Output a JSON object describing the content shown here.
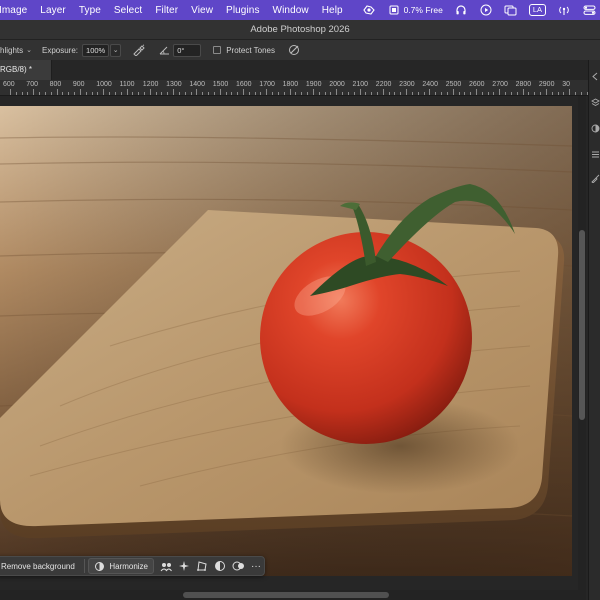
{
  "menubar": {
    "items": [
      "Image",
      "Layer",
      "Type",
      "Select",
      "Filter",
      "View",
      "Plugins",
      "Window",
      "Help"
    ],
    "status": {
      "cpu_text": "0.7% Free",
      "input_source": "LA"
    },
    "icons": [
      "menubar-app-icon",
      "cpu-monitor-icon",
      "headphones-icon",
      "play-icon",
      "window-icon",
      "input-source-icon",
      "antenna-icon",
      "control-center-icon"
    ]
  },
  "window": {
    "title": "Adobe Photoshop 2026"
  },
  "options_bar": {
    "range_value": "hlights",
    "exposure_label": "Exposure:",
    "exposure_value": "100%",
    "angle_value": "0°",
    "protect_tones_label": "Protect Tones",
    "protect_tones_checked": false
  },
  "document_tab": {
    "label": "RGB/8) *"
  },
  "ruler": {
    "labels": [
      "600",
      "700",
      "800",
      "900",
      "1000",
      "1100",
      "1200",
      "1300",
      "1400",
      "1500",
      "1600",
      "1700",
      "1800",
      "1900",
      "2000",
      "2100",
      "2200",
      "2300",
      "2400",
      "2500",
      "2600",
      "2700",
      "2800",
      "2900",
      "30"
    ]
  },
  "contextual_taskbar": {
    "remove_background_label": "Remove background",
    "harmonize_label": "Harmonize",
    "more_label": "···"
  },
  "colors": {
    "menubar": "#5f46c8",
    "panel": "#323232",
    "canvas_bg": "#262626"
  }
}
